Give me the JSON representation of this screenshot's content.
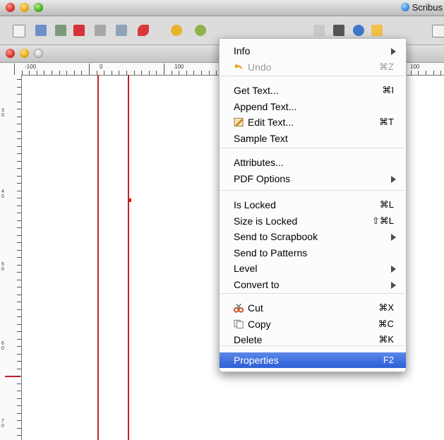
{
  "window": {
    "title": "Scribus"
  },
  "menu": {
    "groups": [
      [
        {
          "label": "Info",
          "submenu": true
        },
        {
          "label": "Undo",
          "shortcut": "⌘Z",
          "disabled": true,
          "icon": "undo-icon"
        }
      ],
      [
        {
          "label": "Get Text...",
          "shortcut": "⌘I"
        },
        {
          "label": "Append Text..."
        },
        {
          "label": "Edit Text...",
          "shortcut": "⌘T",
          "icon": "edit-text-icon"
        },
        {
          "label": "Sample Text"
        }
      ],
      [
        {
          "label": "Attributes..."
        },
        {
          "label": "PDF Options",
          "submenu": true
        }
      ],
      [
        {
          "label": "Is Locked",
          "shortcut": "⌘L"
        },
        {
          "label": "Size is Locked",
          "shortcut": "⇧⌘L"
        },
        {
          "label": "Send to Scrapbook",
          "submenu": true
        },
        {
          "label": "Send to Patterns"
        },
        {
          "label": "Level",
          "submenu": true
        },
        {
          "label": "Convert to",
          "submenu": true
        }
      ],
      [
        {
          "label": "Cut",
          "shortcut": "⌘X",
          "icon": "scissors-icon"
        },
        {
          "label": "Copy",
          "shortcut": "⌘C",
          "icon": "copy-icon"
        },
        {
          "label": "Delete",
          "shortcut": "⌘K"
        }
      ],
      [
        {
          "label": "Properties",
          "shortcut": "F2",
          "selected": true
        }
      ]
    ]
  },
  "ruler": {
    "h_labels": [
      "-100",
      "0",
      "100",
      "100"
    ],
    "v_labels": [
      "3\n0",
      "4\n0",
      "5\n0",
      "6\n0",
      "7\n0"
    ]
  },
  "colors": {
    "guide": "#c0202a",
    "selection": "#2c5fd6"
  }
}
